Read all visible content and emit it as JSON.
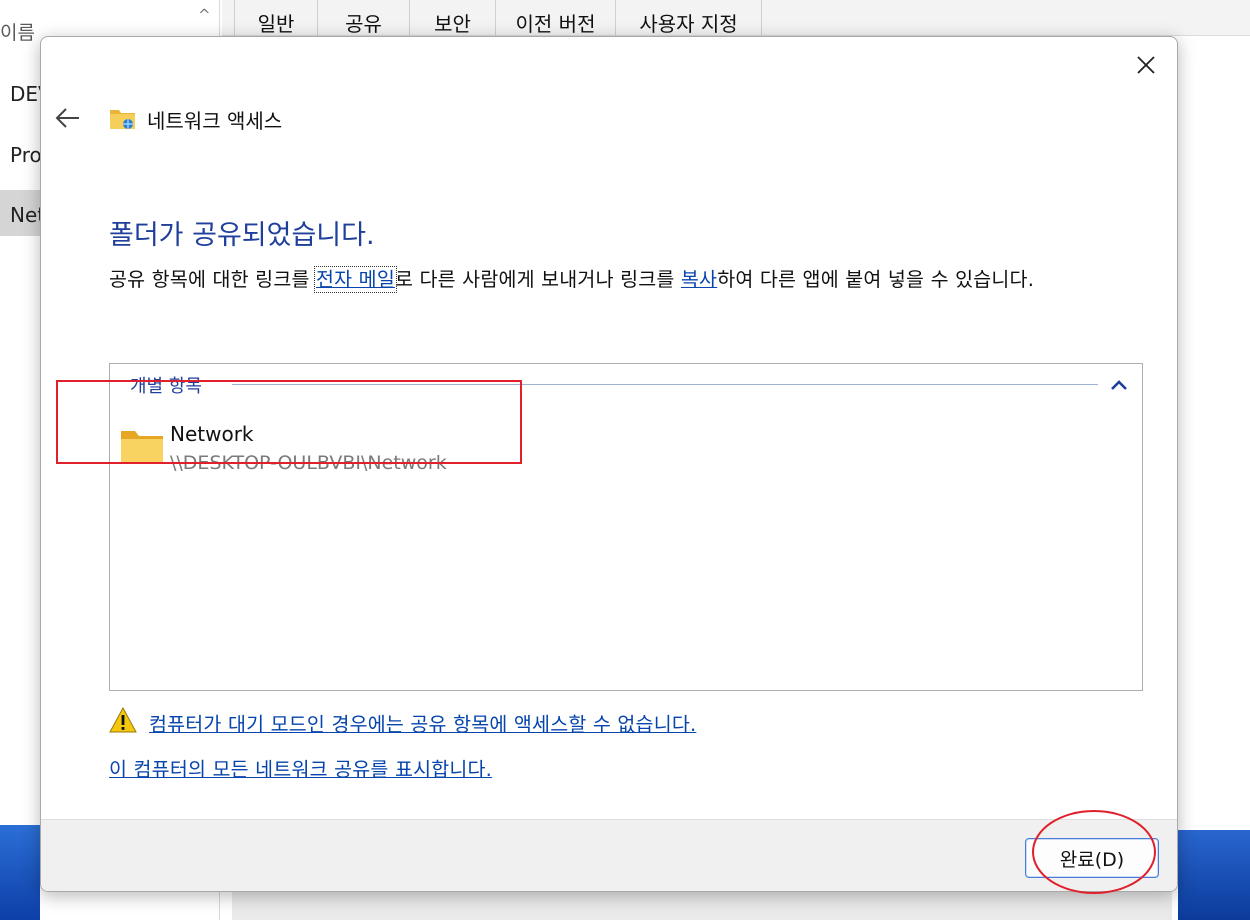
{
  "background": {
    "column_header": "이름",
    "rows": [
      "DEV",
      "Pro",
      "Net"
    ],
    "tabs": [
      "일반",
      "공유",
      "보안",
      "이전 버전",
      "사용자 지정"
    ]
  },
  "dialog": {
    "title": "네트워크 액세스",
    "heading": "폴더가 공유되었습니다.",
    "description": {
      "part1": "공유 항목에 대한 링크를 ",
      "email_link": "전자 메일",
      "part2": "로 다른 사람에게 보내거나 링크를 ",
      "copy_link": "복사",
      "part3": "하여 다른 앱에 붙여 넣을 수 있습니다."
    },
    "group": {
      "label": "개별 항목",
      "items": [
        {
          "name": "Network",
          "path": "\\\\DESKTOP-OULBVBI\\Network"
        }
      ]
    },
    "warning_link": "컴퓨터가 대기 모드인 경우에는 공유 항목에 액세스할 수 없습니다.",
    "shares_link": "이 컴퓨터의 모든 네트워크 공유를 표시합니다.",
    "done_button": "완료(D)"
  },
  "colors": {
    "heading": "#1f3f9b",
    "link": "#0645ad",
    "annotation_red": "#e0202a",
    "footer_bg": "#f0f0f0",
    "button_border": "#4a7fd8"
  },
  "icons": {
    "close": "close-icon",
    "back": "back-arrow-icon",
    "title": "network-folder-icon",
    "collapse": "chevron-up-icon",
    "item": "folder-icon",
    "warning": "warning-icon"
  }
}
